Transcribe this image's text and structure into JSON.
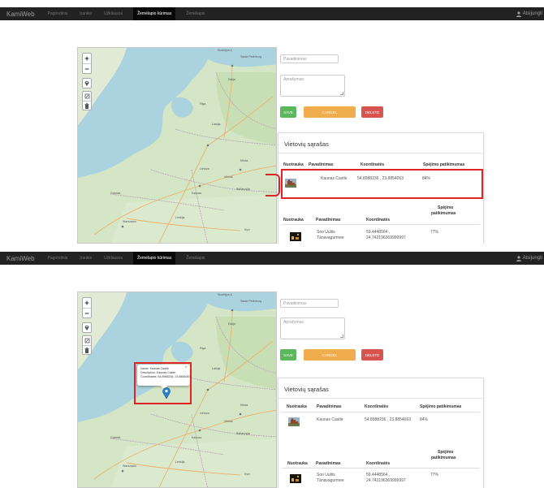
{
  "nav": {
    "brand": "KamiWeb",
    "items": [
      "Pagrindinis",
      "Įrankis",
      "Užklausos",
      "Žemėlapio kūrimas",
      "Žemėlapis"
    ],
    "active_index": 3,
    "user": "Atsijungti"
  },
  "form": {
    "name_placeholder": "Pavadinimas",
    "desc_placeholder": "Aprašymas",
    "save_label": "SAVE",
    "cancel_label": "CANCEL",
    "delete_label": "DELETE"
  },
  "map": {
    "zoom_in": "+",
    "zoom_out": "−",
    "labels": [
      "Suomijos įl.",
      "Estija",
      "Latvija",
      "Lietuva",
      "Baltarusija",
      "Lenkija",
      "Warszawa",
      "Minsk",
      "Riga",
      "Vilnius",
      "Kaunas",
      "Sankt Peterburg",
      "Gdańsk",
      "Kyiv"
    ]
  },
  "popup": {
    "line1": "Name: Kaunas Castle",
    "line2": "Description: Kaunas Castle",
    "line3": "Coordinates: 54.8988236, 23.8854063",
    "close": "×"
  },
  "list": {
    "title": "Vietovių sąrašas",
    "headers": [
      "Nuotrauka",
      "Pavadinimas",
      "Koordinatės",
      "Spėjimo patikimumas"
    ],
    "headers_narrow": [
      "Nuotrauka",
      "Pavadinimas",
      "Koordinatės",
      "Spėjimo",
      "patikimumas"
    ],
    "rows": [
      {
        "name": "Kaunas Castle",
        "coords": "54.8988236 , 23.8854063",
        "confidence": "84%"
      },
      {
        "name_line1": "Soo Uulits",
        "name_line2": "Tänavagurmee",
        "coords_line1": "59.4448564 ,",
        "coords_line2": "24.742196369999997",
        "confidence": "77%"
      }
    ]
  },
  "colors": {
    "navbar": "#222222",
    "save": "#5cb85c",
    "cancel": "#f0ad4e",
    "delete": "#d9534f",
    "highlight": "#e02424",
    "marker": "#2a81cb"
  }
}
